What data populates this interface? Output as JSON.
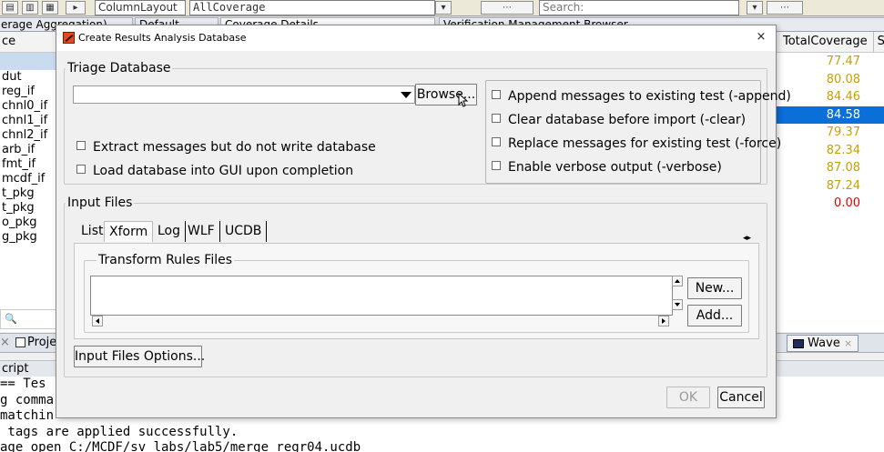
{
  "background": {
    "toolbar": {
      "layout_label": "ColumnLayout",
      "layout_value": "AllCoverage",
      "search_label": "Search:"
    },
    "tabs": [
      {
        "label": "erage Aggregation)"
      },
      {
        "label": "Default"
      },
      {
        "label": "Coverage Details"
      },
      {
        "label": "Verification Management Browser"
      }
    ],
    "left_panel": {
      "header": "ce",
      "rows": [
        "dut",
        "reg_if",
        "chnl0_if",
        "chnl1_if",
        "chnl2_if",
        "arb_if",
        "fmt_if",
        "mcdf_if",
        "t_pkg",
        "t_pkg",
        "o_pkg",
        "g_pkg"
      ]
    },
    "right_panel": {
      "header_col1": "TotalCoverage",
      "header_col2": "S",
      "values": [
        {
          "text": "77.47",
          "status": "warn"
        },
        {
          "text": "80.08",
          "status": "warn"
        },
        {
          "text": "84.46",
          "status": "warn"
        },
        {
          "text": "84.58",
          "status": "selected"
        },
        {
          "text": "79.37",
          "status": "warn"
        },
        {
          "text": "82.34",
          "status": "warn"
        },
        {
          "text": "87.08",
          "status": "warn"
        },
        {
          "text": "87.24",
          "status": "warn"
        },
        {
          "text": "0.00",
          "status": "bad"
        }
      ],
      "colors": {
        "warn": "#c8a000",
        "bad": "#e00000",
        "selected": "#0a6fd8"
      }
    },
    "project_tab": "Proje",
    "wave_tab": "Wave",
    "transcript_header": "cript",
    "transcript_lines": [
      "== Tes",
      "g comma",
      "matchin",
      " tags are applied successfully.",
      "age open C:/MCDF/sv labs/lab5/merge regr04.ucdb"
    ]
  },
  "dialog": {
    "title": "Create Results Analysis Database",
    "close_glyph": "×",
    "triage": {
      "legend": "Triage Database",
      "path_value": "",
      "browse_label": "Browse...",
      "left_options": [
        {
          "label": "Extract messages but do not write database",
          "checked": false
        },
        {
          "label": "Load database into GUI upon completion",
          "checked": false
        }
      ],
      "right_options": [
        {
          "label": "Append messages to existing test (-append)",
          "checked": false
        },
        {
          "label": "Clear database before import (-clear)",
          "checked": false
        },
        {
          "label": "Replace messages for existing test (-force)",
          "checked": false
        },
        {
          "label": "Enable verbose output (-verbose)",
          "checked": false
        }
      ]
    },
    "input_files": {
      "legend": "Input Files",
      "tabs": [
        "List",
        "Xform",
        "Log",
        "WLF",
        "UCDB"
      ],
      "active_tab": "Xform",
      "transform_rules_legend": "Transform Rules Files",
      "new_label": "New...",
      "add_label": "Add...",
      "options_label": "Input Files Options..."
    },
    "ok_label": "OK",
    "cancel_label": "Cancel"
  }
}
